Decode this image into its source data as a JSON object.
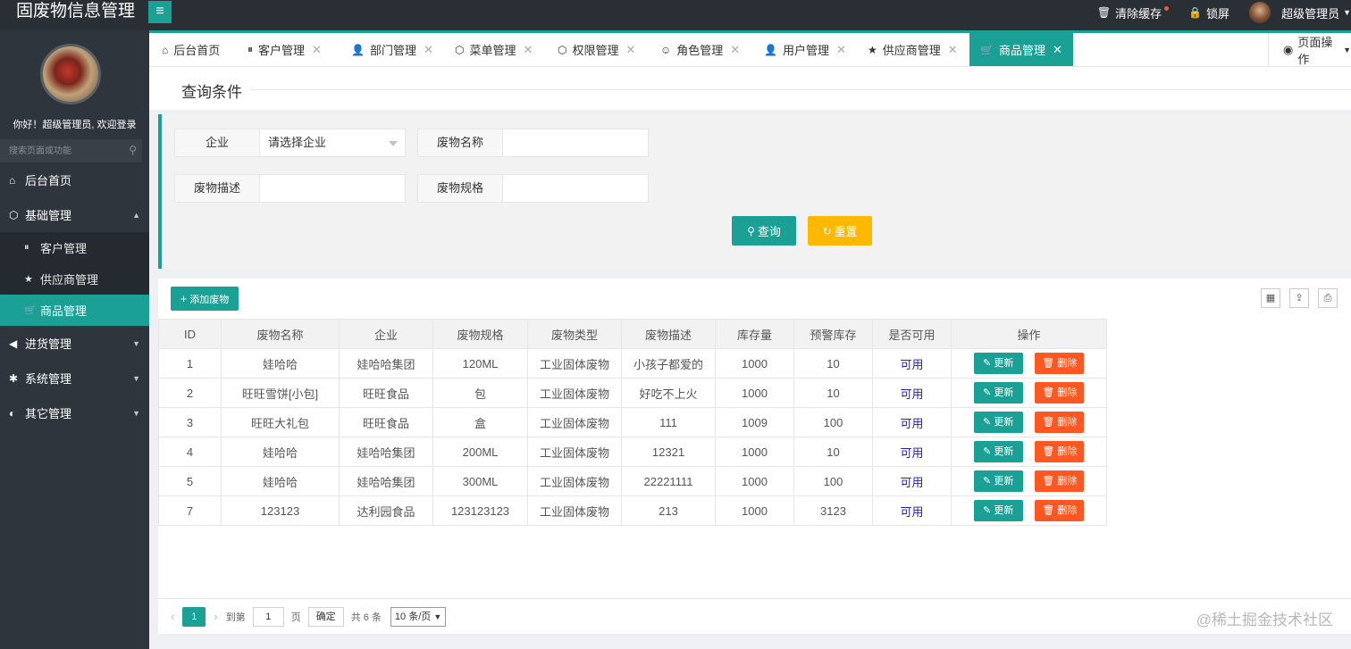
{
  "header": {
    "brand": "固废物信息管理",
    "menu_toggle_icon": "hamburger-icon",
    "clear_cache": "清除缓存",
    "lock_screen": "锁屏",
    "user_name": "超级管理员"
  },
  "sidebar": {
    "welcome": "你好！超级管理员, 欢迎登录",
    "search_placeholder": "搜索页面或功能",
    "items": [
      {
        "label": "后台首页",
        "icon": "home-icon"
      },
      {
        "label": "基础管理",
        "icon": "cube-icon"
      },
      {
        "label": "进货管理",
        "icon": "volume-icon"
      },
      {
        "label": "系统管理",
        "icon": "gear-icon"
      },
      {
        "label": "其它管理",
        "icon": "circle-icon"
      }
    ],
    "sub_items": [
      {
        "label": "客户管理",
        "icon": "pause-circle-icon"
      },
      {
        "label": "供应商管理",
        "icon": "star-icon"
      },
      {
        "label": "商品管理",
        "icon": "cart-icon"
      }
    ]
  },
  "tabs": [
    {
      "label": "后台首页"
    },
    {
      "label": "客户管理"
    },
    {
      "label": "部门管理"
    },
    {
      "label": "菜单管理"
    },
    {
      "label": "权限管理"
    },
    {
      "label": "角色管理"
    },
    {
      "label": "用户管理"
    },
    {
      "label": "供应商管理"
    },
    {
      "label": "商品管理"
    }
  ],
  "page_ops": "页面操作",
  "query": {
    "title": "查询条件",
    "company_label": "企业",
    "company_placeholder": "请选择企业",
    "waste_name_label": "废物名称",
    "waste_desc_label": "废物描述",
    "waste_spec_label": "废物规格",
    "search_btn": "查询",
    "reset_btn": "重置"
  },
  "table": {
    "add_btn": "添加废物",
    "columns": [
      "ID",
      "废物名称",
      "企业",
      "废物规格",
      "废物类型",
      "废物描述",
      "库存量",
      "预警库存",
      "是否可用",
      "操作"
    ],
    "update_label": "更新",
    "delete_label": "删除",
    "rows": [
      [
        "1",
        "娃哈哈",
        "娃哈哈集团",
        "120ML",
        "工业固体废物",
        "小孩子都爱的",
        "1000",
        "10",
        "可用"
      ],
      [
        "2",
        "旺旺雪饼[小包]",
        "旺旺食品",
        "包",
        "工业固体废物",
        "好吃不上火",
        "1000",
        "10",
        "可用"
      ],
      [
        "3",
        "旺旺大礼包",
        "旺旺食品",
        "盒",
        "工业固体废物",
        "111",
        "1009",
        "100",
        "可用"
      ],
      [
        "4",
        "娃哈哈",
        "娃哈哈集团",
        "200ML",
        "工业固体废物",
        "12321",
        "1000",
        "10",
        "可用"
      ],
      [
        "5",
        "娃哈哈",
        "娃哈哈集团",
        "300ML",
        "工业固体废物",
        "22221111",
        "1000",
        "100",
        "可用"
      ],
      [
        "7",
        "123123",
        "达利园食品",
        "123123123",
        "工业固体废物",
        "213",
        "1000",
        "3123",
        "可用"
      ]
    ]
  },
  "pager": {
    "current": "1",
    "goto_label": "到第",
    "goto_value": "1",
    "page_unit": "页",
    "confirm": "确定",
    "total": "共 6 条",
    "per_page": "10 条/页"
  },
  "watermark": "@稀土掘金技术社区",
  "colors": {
    "accent": "#1aa094",
    "warning": "#ffb800",
    "danger": "#ff5722",
    "sidebar": "#2f353d"
  }
}
